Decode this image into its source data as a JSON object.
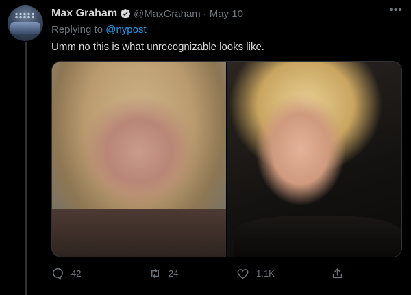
{
  "tweet": {
    "author_name": "Max Graham",
    "handle": "@MaxGraham",
    "separator": "·",
    "date": "May 10",
    "more_icon": "more-icon",
    "replying_prefix": "Replying to ",
    "replying_to": "@nypost",
    "text": "Umm no this is what unrecognizable looks like.",
    "verified_icon": "verified-badge-icon"
  },
  "actions": {
    "reply_count": "42",
    "retweet_count": "24",
    "like_count": "1.1K"
  },
  "colors": {
    "background": "#000000",
    "text": "#d9d9d9",
    "muted": "#6e767d",
    "link": "#1d9bf0"
  }
}
